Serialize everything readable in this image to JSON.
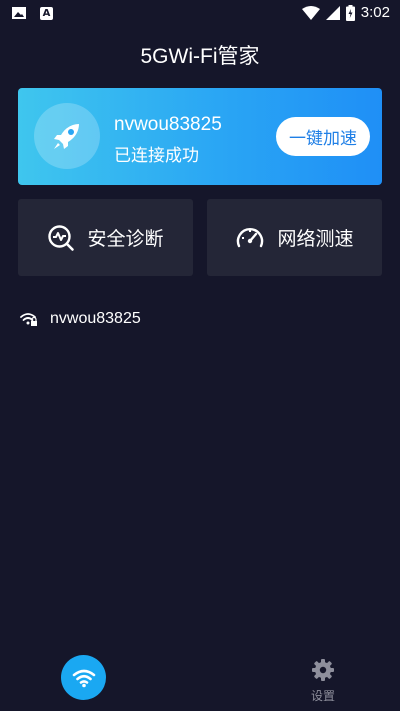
{
  "status_bar": {
    "time": "3:02",
    "left_icons": [
      "image-notification-icon",
      "a-notification-icon"
    ],
    "right_icons": [
      "wifi-signal-icon",
      "cell-signal-icon",
      "battery-charging-icon"
    ]
  },
  "header": {
    "title": "5GWi-Fi管家"
  },
  "hero": {
    "ssid": "nvwou83825",
    "status": "已连接成功",
    "boost_label": "一键加速",
    "icon": "rocket-icon"
  },
  "tiles": [
    {
      "label": "安全诊断",
      "icon": "security-scan-icon"
    },
    {
      "label": "网络测速",
      "icon": "speedometer-icon"
    }
  ],
  "network": {
    "name": "nvwou83825",
    "icon": "locked-wifi-icon"
  },
  "bottom_nav": {
    "items": [
      {
        "label": "",
        "icon": "wifi-icon",
        "active": true
      },
      {
        "label": "设置",
        "icon": "gear-icon",
        "active": false
      }
    ]
  },
  "colors": {
    "background": "#15162a",
    "tile": "#242637",
    "accent": "#1aa8f2",
    "gradient_start": "#3fc6ee",
    "gradient_end": "#1f8ff6"
  }
}
